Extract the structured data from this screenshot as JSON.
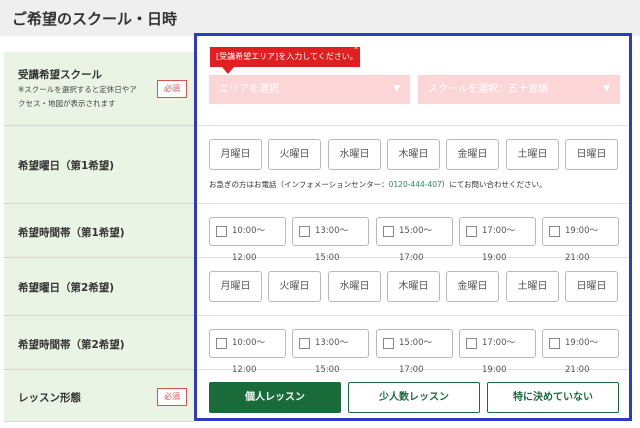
{
  "section_title": "ご希望のスクール・日時",
  "required_label": "必須",
  "rows": {
    "school": {
      "label": "受講希望スクール",
      "note_line1": "※スクールを選択すると定休日やア",
      "note_line2": "クセス・地図が表示されます"
    },
    "day1": {
      "label": "希望曜日（第1希望)"
    },
    "time1": {
      "label": "希望時間帯（第1希望)"
    },
    "day2": {
      "label": "希望曜日（第2希望)"
    },
    "time2": {
      "label": "希望時間帯（第2希望)"
    },
    "lesson": {
      "label": "レッスン形態"
    }
  },
  "tooltip": {
    "text": "[受講希望エリア]を入力してください。",
    "close": "x"
  },
  "selects": {
    "area_placeholder": "エリアを選択",
    "school_placeholder": "スクールを選択：五十音順",
    "arrow": "▼"
  },
  "days": [
    "月曜日",
    "火曜日",
    "水曜日",
    "木曜日",
    "金曜日",
    "土曜日",
    "日曜日"
  ],
  "times": [
    "10:00〜12:00",
    "13:00〜15:00",
    "15:00〜17:00",
    "17:00〜19:00",
    "19:00〜21:00"
  ],
  "phone_note": {
    "before": "お急ぎの方はお電話（インフォメーションセンター：",
    "tel": "0120-444-407",
    "after": "）にてお問い合わせください。"
  },
  "lesson_types": [
    "個人レッスン",
    "少人数レッスン",
    "特に決めていない"
  ],
  "lesson_selected": "個人レッスン",
  "colors": {
    "brand_green": "#1a6b3a",
    "error_red": "#e02020",
    "frame_blue": "#2d3bc2",
    "label_bg": "#eaf4e4"
  }
}
